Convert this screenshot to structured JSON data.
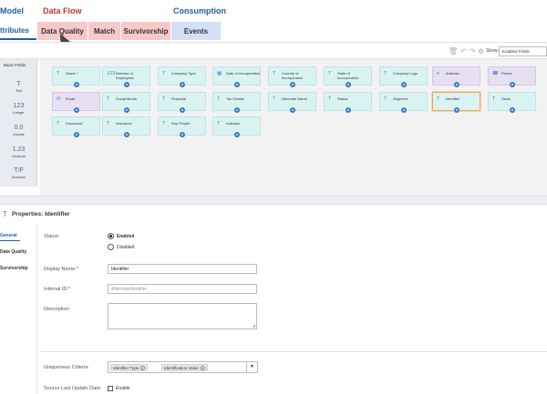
{
  "header": {
    "sections": [
      {
        "label": "Model",
        "color": "#1f5fa8"
      },
      {
        "label": "Data Flow",
        "color": "#c0392b"
      },
      {
        "label": "Consumption",
        "color": "#1f5fa8"
      }
    ],
    "tabs": [
      {
        "label": "ttributes",
        "bg": "#ffffff",
        "color": "#1f5fa8"
      },
      {
        "label": "Data Quality",
        "bg": "#f7c9c9"
      },
      {
        "label": "Match",
        "bg": "#f7c9c9"
      },
      {
        "label": "Survivorship",
        "bg": "#f7c9c9"
      },
      {
        "label": "Events",
        "bg": "#d3e0f5"
      }
    ]
  },
  "toolbar": {
    "icons": [
      "trash-icon",
      "undo-icon",
      "redo-icon",
      "settings-icon"
    ],
    "show_label": "Show:",
    "show_value": "Enabled Fields"
  },
  "sidebar": {
    "head": "Basic Fields",
    "items": [
      {
        "glyph": "T",
        "label": "Text",
        "icon": "text-icon"
      },
      {
        "glyph": "123",
        "label": "Integer",
        "icon": "integer-icon"
      },
      {
        "glyph": "0.0",
        "label": "Double",
        "icon": "double-icon"
      },
      {
        "glyph": "1.23",
        "label": "Decimal",
        "icon": "decimal-icon"
      },
      {
        "glyph": "T/F",
        "label": "Boolean",
        "icon": "boolean-icon"
      }
    ]
  },
  "fields": [
    {
      "label": "Name *",
      "glyph": "T",
      "type": "text"
    },
    {
      "label": "Number of Employees",
      "glyph": "123",
      "type": "integer"
    },
    {
      "label": "Company Type",
      "glyph": "T",
      "type": "text"
    },
    {
      "label": "Date of Incorporation",
      "glyph": "▦",
      "type": "date"
    },
    {
      "label": "Country of Incorporation",
      "glyph": "T",
      "type": "text"
    },
    {
      "label": "State of Incorporation",
      "glyph": "T",
      "type": "text"
    },
    {
      "label": "Company Logo",
      "glyph": "T",
      "type": "text"
    },
    {
      "label": "Address",
      "glyph": "⌖",
      "type": "address",
      "purple": true
    },
    {
      "label": "Phone",
      "glyph": "☎",
      "type": "phone",
      "purple": true
    },
    {
      "label": "Email",
      "glyph": "✉",
      "type": "email",
      "purple": true
    },
    {
      "label": "Social Media",
      "glyph": "T",
      "type": "text"
    },
    {
      "label": "Financial",
      "glyph": "T",
      "type": "text"
    },
    {
      "label": "Tax Details",
      "glyph": "T",
      "type": "text"
    },
    {
      "label": "Alternate Name",
      "glyph": "T",
      "type": "text"
    },
    {
      "label": "Status",
      "glyph": "T",
      "type": "text"
    },
    {
      "label": "Segment",
      "glyph": "T",
      "type": "text"
    },
    {
      "label": "Identifier",
      "glyph": "T",
      "type": "text",
      "selected": true
    },
    {
      "label": "Stock",
      "glyph": "T",
      "type": "text"
    },
    {
      "label": "Document",
      "glyph": "T",
      "type": "text"
    },
    {
      "label": "Insurance",
      "glyph": "T",
      "type": "text"
    },
    {
      "label": "Key People",
      "glyph": "T",
      "type": "text"
    },
    {
      "label": "Indicator",
      "glyph": "T",
      "type": "text"
    }
  ],
  "properties": {
    "title": "Properties: Identifier",
    "tabs": [
      "General",
      "Data Quality",
      "Survivorship"
    ],
    "status_label": "Status:",
    "status_enabled": "Enabled",
    "status_disabled": "Disabled",
    "display_name_label": "Display Name:*",
    "display_name_value": "Identifier",
    "internal_id_label": "Internal ID:*",
    "internal_id_placeholder": "AlternateIdentifier",
    "description_label": "Description:",
    "uniqueness_label": "Uniqueness Criteria:",
    "uniqueness_chips": [
      "Identifier Type",
      "Identification Value"
    ],
    "source_update_label": "Source Last Update Date:",
    "source_update_enable": "Enable"
  }
}
